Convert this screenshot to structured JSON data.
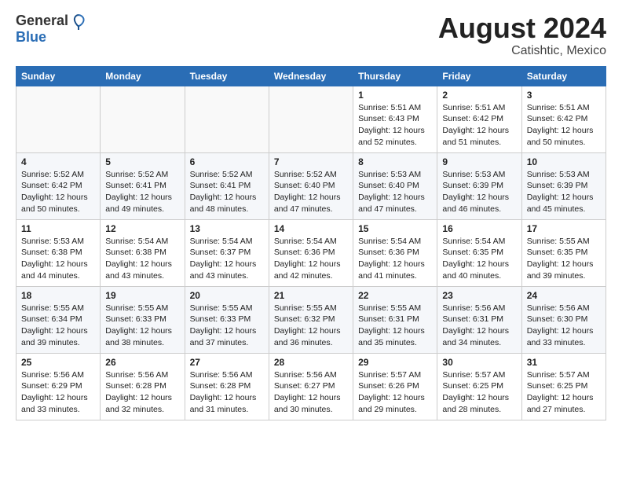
{
  "header": {
    "logo_general": "General",
    "logo_blue": "Blue",
    "title": "August 2024",
    "location": "Catishtic, Mexico"
  },
  "weekdays": [
    "Sunday",
    "Monday",
    "Tuesday",
    "Wednesday",
    "Thursday",
    "Friday",
    "Saturday"
  ],
  "weeks": [
    [
      {
        "day": "",
        "info": ""
      },
      {
        "day": "",
        "info": ""
      },
      {
        "day": "",
        "info": ""
      },
      {
        "day": "",
        "info": ""
      },
      {
        "day": "1",
        "info": "Sunrise: 5:51 AM\nSunset: 6:43 PM\nDaylight: 12 hours\nand 52 minutes."
      },
      {
        "day": "2",
        "info": "Sunrise: 5:51 AM\nSunset: 6:42 PM\nDaylight: 12 hours\nand 51 minutes."
      },
      {
        "day": "3",
        "info": "Sunrise: 5:51 AM\nSunset: 6:42 PM\nDaylight: 12 hours\nand 50 minutes."
      }
    ],
    [
      {
        "day": "4",
        "info": "Sunrise: 5:52 AM\nSunset: 6:42 PM\nDaylight: 12 hours\nand 50 minutes."
      },
      {
        "day": "5",
        "info": "Sunrise: 5:52 AM\nSunset: 6:41 PM\nDaylight: 12 hours\nand 49 minutes."
      },
      {
        "day": "6",
        "info": "Sunrise: 5:52 AM\nSunset: 6:41 PM\nDaylight: 12 hours\nand 48 minutes."
      },
      {
        "day": "7",
        "info": "Sunrise: 5:52 AM\nSunset: 6:40 PM\nDaylight: 12 hours\nand 47 minutes."
      },
      {
        "day": "8",
        "info": "Sunrise: 5:53 AM\nSunset: 6:40 PM\nDaylight: 12 hours\nand 47 minutes."
      },
      {
        "day": "9",
        "info": "Sunrise: 5:53 AM\nSunset: 6:39 PM\nDaylight: 12 hours\nand 46 minutes."
      },
      {
        "day": "10",
        "info": "Sunrise: 5:53 AM\nSunset: 6:39 PM\nDaylight: 12 hours\nand 45 minutes."
      }
    ],
    [
      {
        "day": "11",
        "info": "Sunrise: 5:53 AM\nSunset: 6:38 PM\nDaylight: 12 hours\nand 44 minutes."
      },
      {
        "day": "12",
        "info": "Sunrise: 5:54 AM\nSunset: 6:38 PM\nDaylight: 12 hours\nand 43 minutes."
      },
      {
        "day": "13",
        "info": "Sunrise: 5:54 AM\nSunset: 6:37 PM\nDaylight: 12 hours\nand 43 minutes."
      },
      {
        "day": "14",
        "info": "Sunrise: 5:54 AM\nSunset: 6:36 PM\nDaylight: 12 hours\nand 42 minutes."
      },
      {
        "day": "15",
        "info": "Sunrise: 5:54 AM\nSunset: 6:36 PM\nDaylight: 12 hours\nand 41 minutes."
      },
      {
        "day": "16",
        "info": "Sunrise: 5:54 AM\nSunset: 6:35 PM\nDaylight: 12 hours\nand 40 minutes."
      },
      {
        "day": "17",
        "info": "Sunrise: 5:55 AM\nSunset: 6:35 PM\nDaylight: 12 hours\nand 39 minutes."
      }
    ],
    [
      {
        "day": "18",
        "info": "Sunrise: 5:55 AM\nSunset: 6:34 PM\nDaylight: 12 hours\nand 39 minutes."
      },
      {
        "day": "19",
        "info": "Sunrise: 5:55 AM\nSunset: 6:33 PM\nDaylight: 12 hours\nand 38 minutes."
      },
      {
        "day": "20",
        "info": "Sunrise: 5:55 AM\nSunset: 6:33 PM\nDaylight: 12 hours\nand 37 minutes."
      },
      {
        "day": "21",
        "info": "Sunrise: 5:55 AM\nSunset: 6:32 PM\nDaylight: 12 hours\nand 36 minutes."
      },
      {
        "day": "22",
        "info": "Sunrise: 5:55 AM\nSunset: 6:31 PM\nDaylight: 12 hours\nand 35 minutes."
      },
      {
        "day": "23",
        "info": "Sunrise: 5:56 AM\nSunset: 6:31 PM\nDaylight: 12 hours\nand 34 minutes."
      },
      {
        "day": "24",
        "info": "Sunrise: 5:56 AM\nSunset: 6:30 PM\nDaylight: 12 hours\nand 33 minutes."
      }
    ],
    [
      {
        "day": "25",
        "info": "Sunrise: 5:56 AM\nSunset: 6:29 PM\nDaylight: 12 hours\nand 33 minutes."
      },
      {
        "day": "26",
        "info": "Sunrise: 5:56 AM\nSunset: 6:28 PM\nDaylight: 12 hours\nand 32 minutes."
      },
      {
        "day": "27",
        "info": "Sunrise: 5:56 AM\nSunset: 6:28 PM\nDaylight: 12 hours\nand 31 minutes."
      },
      {
        "day": "28",
        "info": "Sunrise: 5:56 AM\nSunset: 6:27 PM\nDaylight: 12 hours\nand 30 minutes."
      },
      {
        "day": "29",
        "info": "Sunrise: 5:57 AM\nSunset: 6:26 PM\nDaylight: 12 hours\nand 29 minutes."
      },
      {
        "day": "30",
        "info": "Sunrise: 5:57 AM\nSunset: 6:25 PM\nDaylight: 12 hours\nand 28 minutes."
      },
      {
        "day": "31",
        "info": "Sunrise: 5:57 AM\nSunset: 6:25 PM\nDaylight: 12 hours\nand 27 minutes."
      }
    ]
  ]
}
